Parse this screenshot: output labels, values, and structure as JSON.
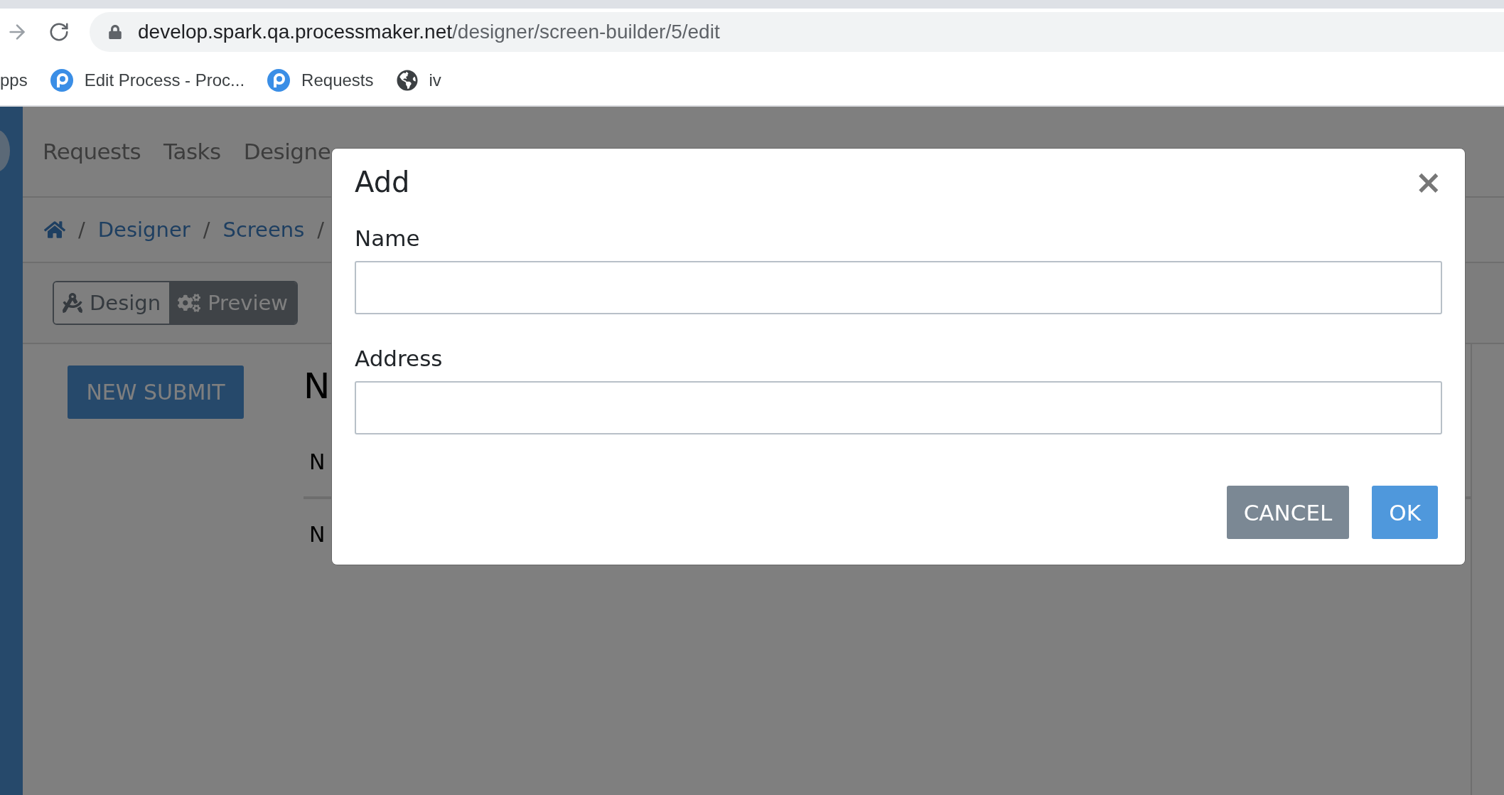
{
  "browser": {
    "url_host": "develop.spark.qa.processmaker.net",
    "url_path": "/designer/screen-builder/5/edit",
    "bookmarks": [
      {
        "label": "pps",
        "kind": "apps"
      },
      {
        "label": "Edit Process - Proc...",
        "kind": "logo"
      },
      {
        "label": "Requests",
        "kind": "logo"
      },
      {
        "label": "iv",
        "kind": "globe"
      }
    ]
  },
  "nav": {
    "items": [
      "Requests",
      "Tasks",
      "Designe"
    ]
  },
  "breadcrumb": {
    "separator": "/",
    "links": [
      "Designer",
      "Screens"
    ]
  },
  "mode_toggle": [
    {
      "label": "Design",
      "kind": "design",
      "selected": false
    },
    {
      "label": "Preview",
      "kind": "preview",
      "selected": true
    }
  ],
  "content": {
    "submit_button": "NEW SUBMIT",
    "heading": "N",
    "rows": [
      "N",
      "N"
    ]
  },
  "modal": {
    "title": "Add",
    "close": "×",
    "fields": [
      {
        "label": "Name"
      },
      {
        "label": "Address"
      }
    ],
    "cancel": "CANCEL",
    "ok": "OK"
  }
}
